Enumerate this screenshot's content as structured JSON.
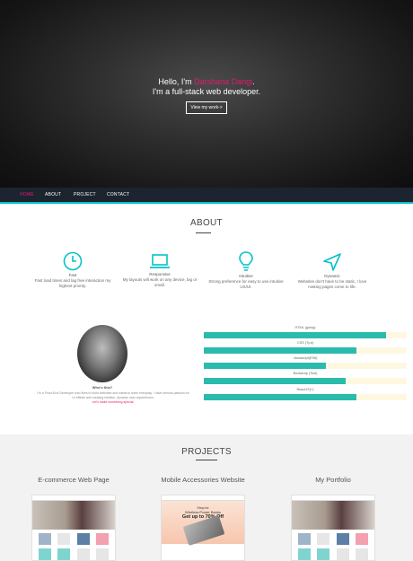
{
  "hero": {
    "greeting": "Hello, I'm ",
    "name": "Darshana Dangi",
    "name_suffix": ".",
    "tagline": "I'm a full-stack web developer.",
    "button_label": "View my work->"
  },
  "nav": {
    "items": [
      {
        "label": "HOME",
        "active": true
      },
      {
        "label": "ABOUT",
        "active": false
      },
      {
        "label": "PROJECT",
        "active": false
      },
      {
        "label": "CONTACT",
        "active": false
      }
    ]
  },
  "about": {
    "title": "ABOUT",
    "features": [
      {
        "icon": "clock-icon",
        "title": "Fast",
        "desc": "Fast load times and lag free interaction my highest priority."
      },
      {
        "icon": "laptop-icon",
        "title": "Responsive",
        "desc": "My layouts will work on any device, big or small."
      },
      {
        "icon": "lightbulb-icon",
        "title": "Intuitive",
        "desc": "Strong preference for easy to use intuitive UX/UI."
      },
      {
        "icon": "send-icon",
        "title": "Dynamic",
        "desc": "Websites don't have to be static, I love making pages come to life."
      }
    ],
    "who_title": "Who's this?",
    "bio": "I'm a Front-End Developer who likes to build websites and wants to learn everyday. I have serious passion for UI effects and creating intuitive, dynamic user experiences.",
    "bio_link": "Let's make something special.",
    "skills": [
      {
        "label": "HTML (going)",
        "percent": 90
      },
      {
        "label": "CSS (Ty.b)",
        "percent": 75
      },
      {
        "label": "Javascript(ES6)",
        "percent": 60
      },
      {
        "label": "Bootstrap (Tool)",
        "percent": 70
      },
      {
        "label": "ReactJS(+)",
        "percent": 75
      }
    ],
    "colors": {
      "accent": "#04c2c9",
      "bar": "#2bbbad",
      "track": "#fff8e1",
      "highlight": "#e31b6d"
    }
  },
  "projects": {
    "title": "PROJECTS",
    "items": [
      {
        "title": "E-commerce Web Page"
      },
      {
        "title": "Mobile Accessories Website",
        "banner_line1": "Shop for",
        "banner_line2": "Wireless Power Banks",
        "banner_line3": "Get up to 70% Off"
      },
      {
        "title": "My Portfolio"
      }
    ]
  }
}
